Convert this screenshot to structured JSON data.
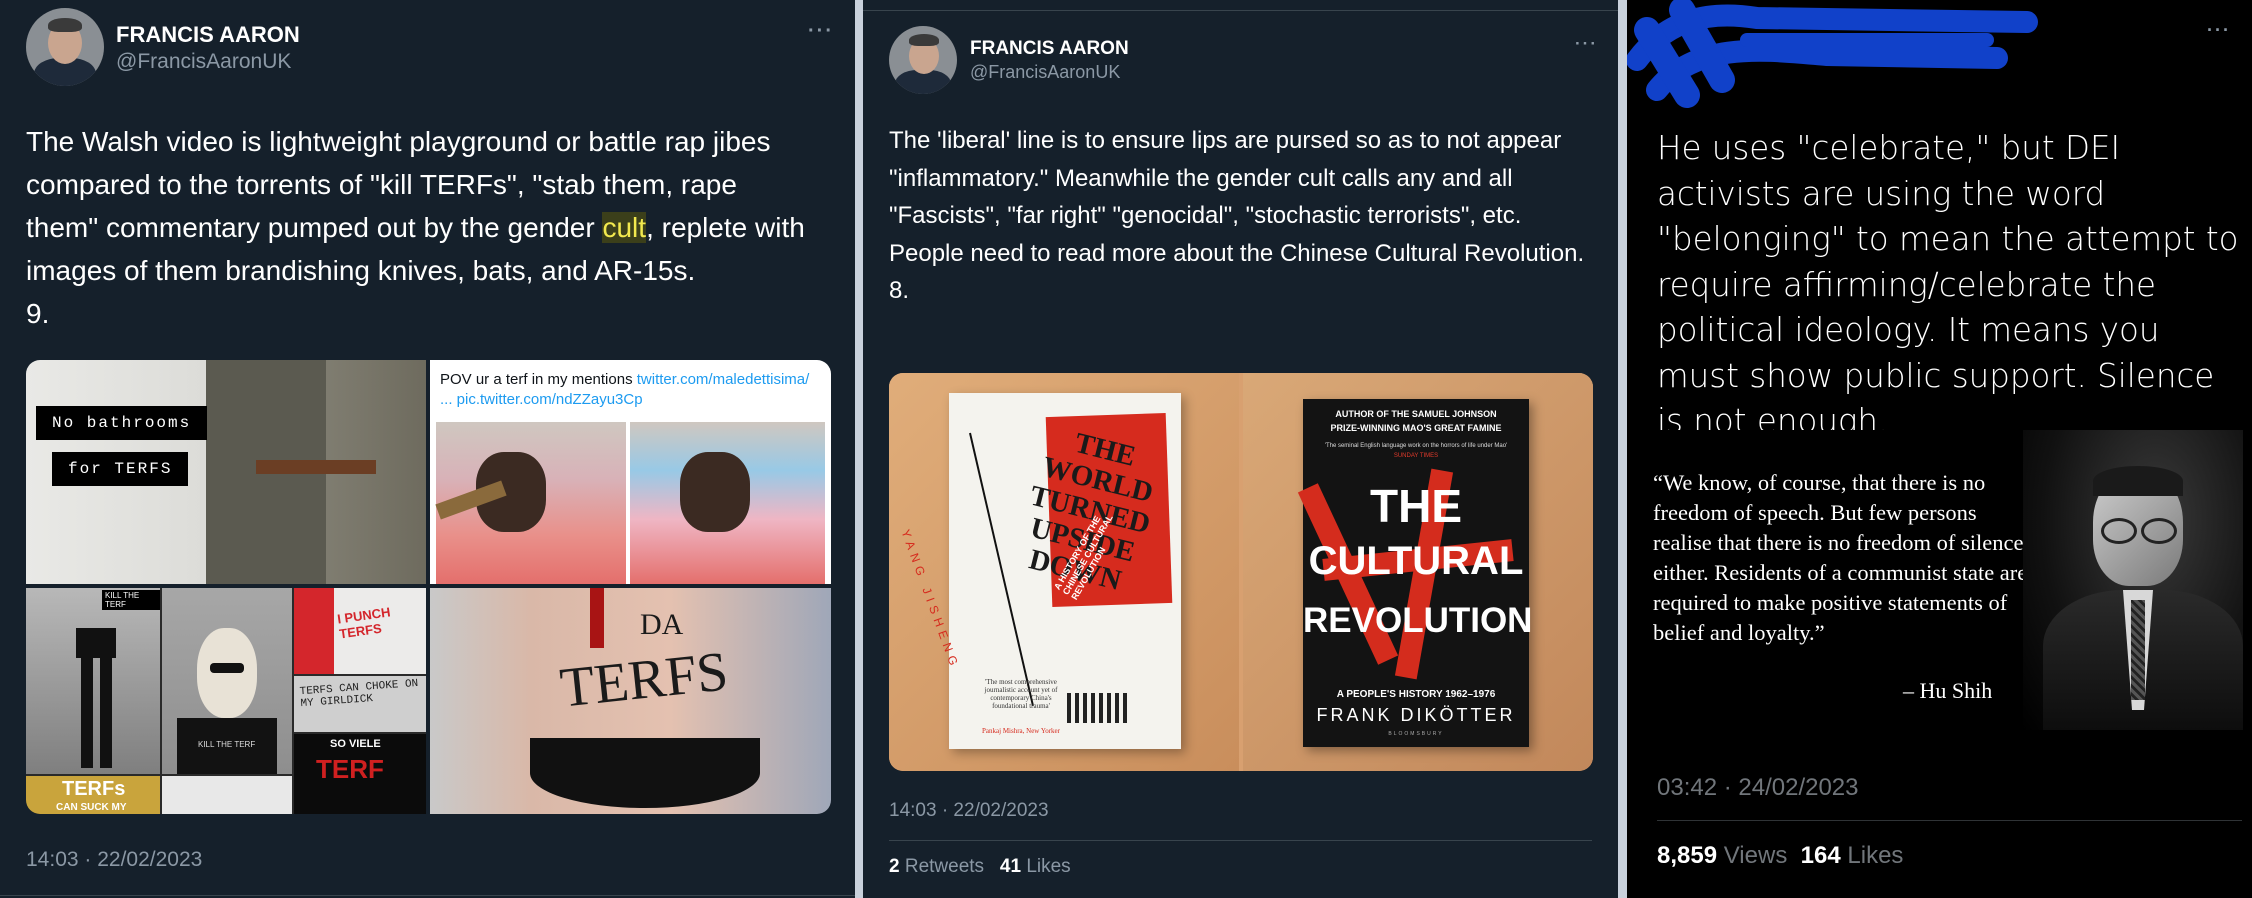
{
  "colors": {
    "bg_dim": "#15202b",
    "bg_black": "#000000",
    "text": "#ffffff",
    "muted": "#8b98a5",
    "link": "#1d9bf0",
    "highlight": "#f2e94e",
    "redact": "#1141c9"
  },
  "tweet1": {
    "name": "FRANCIS AARON",
    "handle": "@FrancisAaronUK",
    "more_icon": "more-icon",
    "text_before": "The Walsh video is lightweight playground or battle rap jibes compared to the torrents of \"kill TERFs\", \"stab them, rape them\" commentary pumped out by the gender ",
    "text_highlight": "cult",
    "text_after": ", replete with images of them brandishing knives, bats, and AR-15s.\n9.",
    "media": {
      "sign_line1": "No bathrooms",
      "sign_line2": "for TERFS",
      "embed_text": "POV ur a terf in my mentions ",
      "embed_link1": "twitter.com/maledettisima/",
      "embed_link2": "... pic.twitter.com/ndZZayu3Cp",
      "tag_kill": "KILL THE TERF",
      "tag_kill2": "KILL THE TERF",
      "punch_text": "I PUNCH TERFS",
      "choke_text": "TERFS CAN CHOKE ON MY GIRLDICK",
      "so_viele": "SO VIELE",
      "terf_red": "TERF",
      "terfs_can": "TERFs",
      "can_suck": "CAN SUCK MY",
      "body_text": "TERFS",
      "da_text": "DA"
    },
    "timestamp": "14:03 · 22/02/2023"
  },
  "tweet2": {
    "name": "FRANCIS AARON",
    "handle": "@FrancisAaronUK",
    "text": "The 'liberal' line is to ensure lips are pursed so as to not appear \"inflammatory.\" Meanwhile the gender cult calls any and all \"Fascists\", \"far right\" \"genocidal\", \"stochastic terrorists\", etc. People need to read more about the Chinese Cultural Revolution.\n8.",
    "book1": {
      "title": "THE WORLD TURNED UPSIDE DOWN",
      "subtitle": "A HISTORY OF THE CHINESE CULTURAL REVOLUTION",
      "author": "YANG JISHENG",
      "blurb": "'The most comprehensive journalistic account yet of contemporary China's foundational trauma'",
      "blurb_source": "Pankaj Mishra, New Yorker"
    },
    "book2": {
      "top1": "AUTHOR OF THE SAMUEL JOHNSON",
      "top2": "PRIZE-WINNING MAO'S GREAT FAMINE",
      "top3": "'The seminal English language work on the horrors of life under Mao'",
      "top4": "SUNDAY TIMES",
      "title1": "THE",
      "title2": "CULTURAL",
      "title3": "REVOLUTION",
      "series": "A PEOPLE'S HISTORY 1962–1976",
      "author": "FRANK DIKÖTTER",
      "publisher": "BLOOMSBURY"
    },
    "timestamp": "14:03 · 22/02/2023",
    "retweets_count": "2",
    "retweets_label": "Retweets",
    "likes_count": "41",
    "likes_label": "Likes"
  },
  "tweet3": {
    "text": "He uses \"celebrate,\" but DEI activists are using the word \"belonging\" to mean the attempt to require affirming/celebrate the political ideology. It means you must show public support. Silence is not enough.",
    "quote": "“We know, of course, that there is no freedom of speech. But few persons realise that there is no freedom of silence, either. Residents of a communist state are required to make positive statements of belief and loyalty.”",
    "quote_author": "– Hu Shih",
    "timestamp": "03:42 · 24/02/2023",
    "views_count": "8,859",
    "views_label": "Views",
    "likes_count": "164",
    "likes_label": "Likes"
  }
}
